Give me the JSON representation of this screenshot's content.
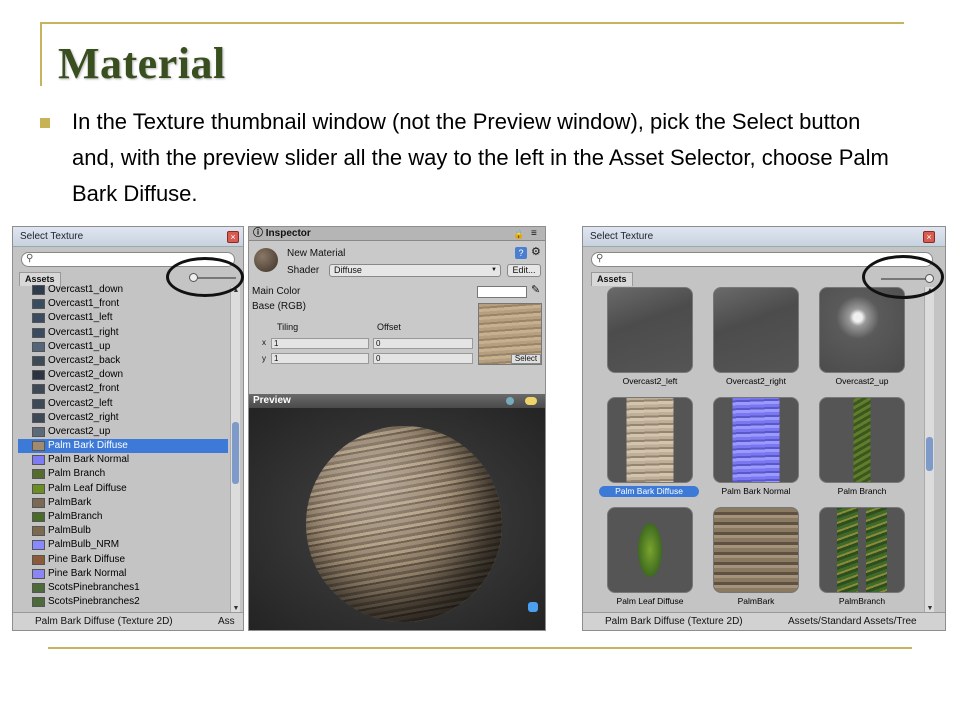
{
  "slide": {
    "title": "Material",
    "bullet_text": "In the Texture thumbnail window (not the Preview window), pick the Select button and, with the preview slider all the way to the left in the Asset Selector, choose Palm Bark Diffuse.",
    "accent_color": "#c8b45a"
  },
  "left_panel": {
    "title": "Select Texture",
    "search_icon": "search-icon",
    "tab": "Assets",
    "slider_level": 0,
    "items": [
      {
        "label": "Overcast1_down",
        "color": "#2e3b4d"
      },
      {
        "label": "Overcast1_front",
        "color": "#3a4c60"
      },
      {
        "label": "Overcast1_left",
        "color": "#3c4c60"
      },
      {
        "label": "Overcast1_right",
        "color": "#3b4b5f"
      },
      {
        "label": "Overcast1_up",
        "color": "#55657a"
      },
      {
        "label": "Overcast2_back",
        "color": "#3e4a56"
      },
      {
        "label": "Overcast2_down",
        "color": "#2b3440"
      },
      {
        "label": "Overcast2_front",
        "color": "#3d4956"
      },
      {
        "label": "Overcast2_left",
        "color": "#3d4956"
      },
      {
        "label": "Overcast2_right",
        "color": "#3d4956"
      },
      {
        "label": "Overcast2_up",
        "color": "#5c6a78"
      },
      {
        "label": "Palm Bark Diffuse",
        "color": "#a08a70"
      },
      {
        "label": "Palm Bark Normal",
        "color": "#7d7cf4"
      },
      {
        "label": "Palm Branch",
        "color": "#556b2f"
      },
      {
        "label": "Palm Leaf Diffuse",
        "color": "#6b8e23"
      },
      {
        "label": "PalmBark",
        "color": "#7a6a55"
      },
      {
        "label": "PalmBranch",
        "color": "#4a6a2a"
      },
      {
        "label": "PalmBulb",
        "color": "#7b6a4d"
      },
      {
        "label": "PalmBulb_NRM",
        "color": "#8888ff"
      },
      {
        "label": "Pine Bark Diffuse",
        "color": "#8a5a3a"
      },
      {
        "label": "Pine Bark Normal",
        "color": "#8a86f2"
      },
      {
        "label": "ScotsPinebranches1",
        "color": "#4d6a3a"
      },
      {
        "label": "ScotsPinebranches2",
        "color": "#4d6a3a"
      }
    ],
    "selected_index": 11,
    "status_name": "Palm Bark Diffuse (Texture 2D)",
    "status_path": "Ass"
  },
  "inspector": {
    "tab_label": "Inspector",
    "material_name": "New Material",
    "shader_label": "Shader",
    "shader_value": "Diffuse",
    "edit_label": "Edit...",
    "main_color_label": "Main Color",
    "base_label": "Base (RGB)",
    "tiling_label": "Tiling",
    "offset_label": "Offset",
    "x_label": "x",
    "y_label": "y",
    "tiling_x": "1",
    "tiling_y": "1",
    "offset_x": "0",
    "offset_y": "0",
    "select_label": "Select",
    "preview_label": "Preview"
  },
  "right_panel": {
    "title": "Select Texture",
    "tab": "Assets",
    "slider_level": 1,
    "thumbnails": [
      {
        "label": "Overcast2_left",
        "kind": "sky"
      },
      {
        "label": "Overcast2_right",
        "kind": "sky"
      },
      {
        "label": "Overcast2_up",
        "kind": "cloud"
      },
      {
        "label": "Palm Bark Diffuse",
        "kind": "bark"
      },
      {
        "label": "Palm Bark Normal",
        "kind": "normal"
      },
      {
        "label": "Palm Branch",
        "kind": "branch"
      },
      {
        "label": "Palm Leaf Diffuse",
        "kind": "leaf"
      },
      {
        "label": "PalmBark",
        "kind": "palmbark"
      },
      {
        "label": "PalmBranch",
        "kind": "branch2"
      }
    ],
    "selected_index": 3,
    "status_name": "Palm Bark Diffuse (Texture 2D)",
    "status_path": "Assets/Standard Assets/Tree"
  }
}
